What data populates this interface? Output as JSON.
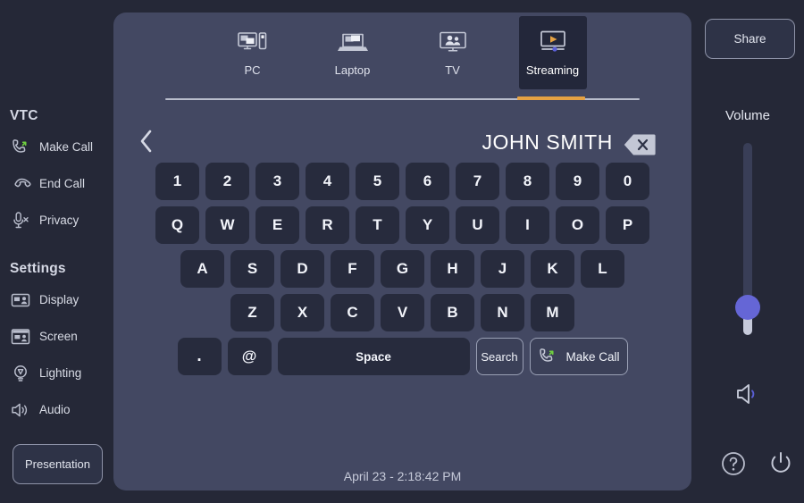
{
  "colors": {
    "background": "#252837",
    "panel": "#434862",
    "key": "#272b3d",
    "accent_orange": "#e6a243",
    "accent_green": "#6fcf3f",
    "slider_thumb": "#6566d6"
  },
  "left_sidebar": {
    "groups": [
      {
        "title": "VTC",
        "items": [
          {
            "label": "Make Call",
            "icon": "phone-call-icon"
          },
          {
            "label": "End Call",
            "icon": "phone-hangup-icon"
          },
          {
            "label": "Privacy",
            "icon": "microphone-mute-icon"
          }
        ]
      },
      {
        "title": "Settings",
        "items": [
          {
            "label": "Display",
            "icon": "display-icon"
          },
          {
            "label": "Screen",
            "icon": "screen-icon"
          },
          {
            "label": "Lighting",
            "icon": "lightbulb-icon"
          },
          {
            "label": "Audio",
            "icon": "speaker-icon"
          }
        ]
      }
    ],
    "presentation_button": "Presentation"
  },
  "tabs": [
    {
      "label": "PC",
      "icon": "desktop-pc-icon",
      "active": false
    },
    {
      "label": "Laptop",
      "icon": "laptop-icon",
      "active": false
    },
    {
      "label": "TV",
      "icon": "tv-icon",
      "active": false
    },
    {
      "label": "Streaming",
      "icon": "streaming-play-icon",
      "active": true
    }
  ],
  "title_row": {
    "back_icon": "chevron-left-icon",
    "entry_name": "JOHN SMITH",
    "backspace_icon": "backspace-icon"
  },
  "keyboard": {
    "rows": [
      [
        "1",
        "2",
        "3",
        "4",
        "5",
        "6",
        "7",
        "8",
        "9",
        "0"
      ],
      [
        "Q",
        "W",
        "E",
        "R",
        "T",
        "Y",
        "U",
        "I",
        "O",
        "P"
      ],
      [
        "A",
        "S",
        "D",
        "F",
        "G",
        "H",
        "J",
        "K",
        "L"
      ],
      [
        "Z",
        "X",
        "C",
        "V",
        "B",
        "N",
        "M"
      ]
    ],
    "bottom_row": {
      "dot": ".",
      "at": "@",
      "space": "Space",
      "search": "Search",
      "make_call": "Make Call",
      "make_call_icon": "phone-call-icon"
    }
  },
  "timestamp": "April 23 - 2:18:42 PM",
  "right_sidebar": {
    "share_button": "Share",
    "volume_label": "Volume",
    "volume_value": 18,
    "speaker_icon": "speaker-icon",
    "help_icon": "help-circle-icon",
    "power_icon": "power-icon"
  }
}
